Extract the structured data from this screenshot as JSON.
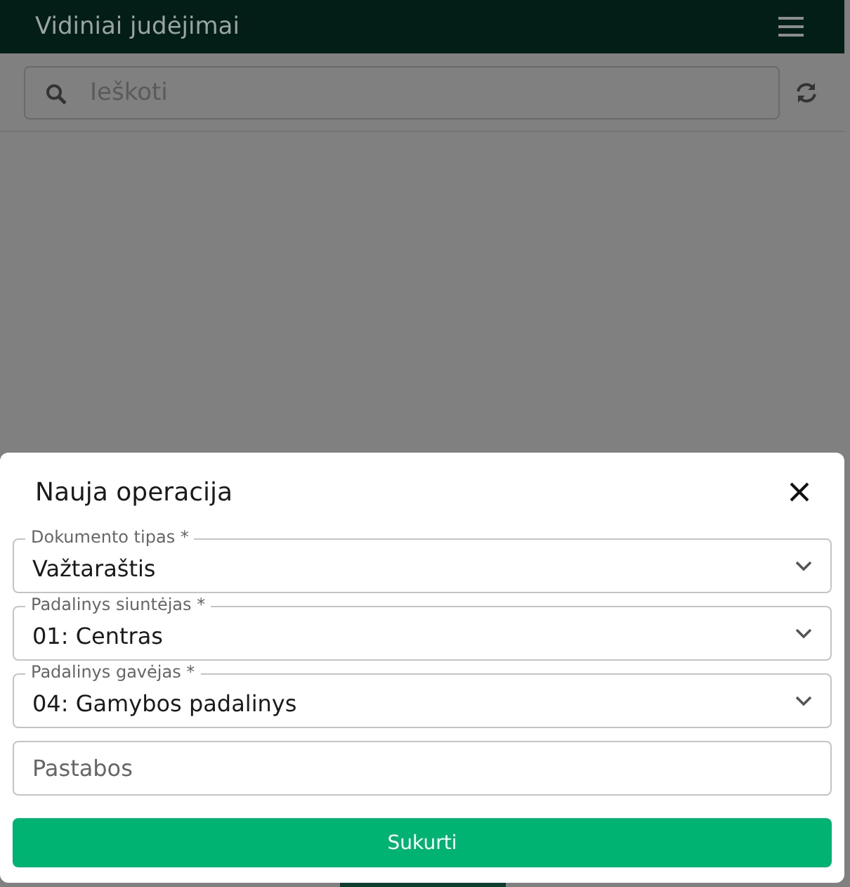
{
  "header": {
    "title": "Vidiniai judėjimai"
  },
  "search": {
    "placeholder": "Ieškoti"
  },
  "dialog": {
    "title": "Nauja operacija",
    "fields": [
      {
        "kind": "select",
        "label": "Dokumento tipas *",
        "value": "Važtaraštis"
      },
      {
        "kind": "select",
        "label": "Padalinys siuntėjas *",
        "value": "01: Centras"
      },
      {
        "kind": "select",
        "label": "Padalinys gavėjas *",
        "value": "04: Gamybos padalinys"
      },
      {
        "kind": "text",
        "placeholder": "Pastabos"
      }
    ],
    "submit": "Sukurti"
  }
}
